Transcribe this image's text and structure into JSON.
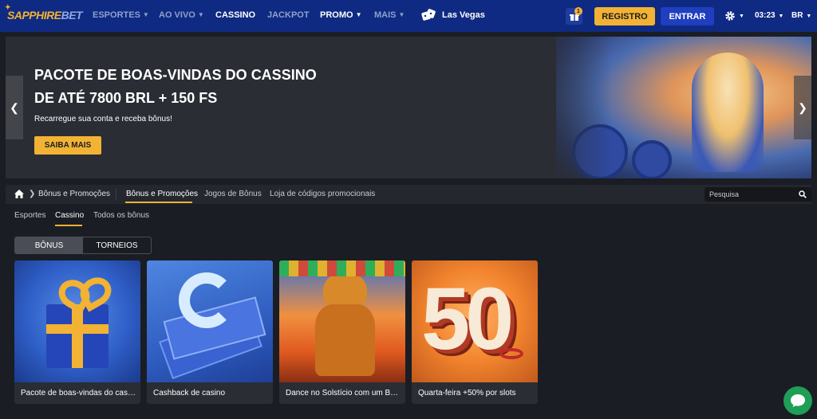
{
  "brand": {
    "part1": "SAPPHIRE",
    "part2": "BET"
  },
  "nav": {
    "esportes": "ESPORTES",
    "ao_vivo": "AO VIVO",
    "cassino": "CASSINO",
    "jackpot": "JACKPOT",
    "promo": "PROMO",
    "mais": "MAIS",
    "las_vegas": "Las Vegas",
    "gift_count": "1",
    "registro": "REGISTRO",
    "entrar": "ENTRAR",
    "time": "03:23",
    "lang": "BR"
  },
  "banner": {
    "title": "PACOTE DE BOAS-VINDAS DO CASSINO DE ATÉ 7800 BRL + 150 FS",
    "subtitle": "Recarregue sua conta e receba bônus!",
    "cta": "SAIBA MAIS"
  },
  "breadcrumb": {
    "current": "Bônus e Promoções",
    "tabs": [
      "Bônus e Promoções",
      "Jogos de Bônus",
      "Loja de códigos promocionais"
    ],
    "search_placeholder": "Pesquisa"
  },
  "subtabs": [
    "Esportes",
    "Cassino",
    "Todos os bônus"
  ],
  "toggle": [
    "BÔNUS",
    "TORNEIOS"
  ],
  "cards": [
    {
      "label": "Pacote de boas-vindas do cassino"
    },
    {
      "label": "Cashback de casino"
    },
    {
      "label": "Dance no Solstício com um Bônus"
    },
    {
      "label": "Quarta-feira +50% por slots"
    }
  ],
  "card_art": {
    "fifty": "50"
  },
  "colors": {
    "nav_bg": "#0f2a82",
    "accent": "#f2b233",
    "page_bg": "#1a1d23",
    "chat": "#1e9e56"
  }
}
